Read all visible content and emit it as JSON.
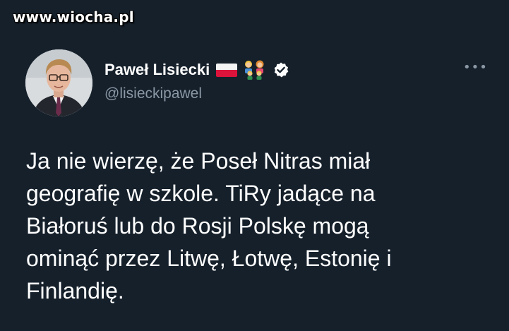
{
  "watermark": "www.wiocha.pl",
  "author": {
    "name": "Paweł Lisiecki",
    "handle": "@lisieckipawel"
  },
  "icons": {
    "flag": "poland-flag-icon",
    "family": "family-emoji-icon",
    "verified": "verified-badge-icon",
    "more": "more-options-icon"
  },
  "colors": {
    "background": "#15202b",
    "text": "#ffffff",
    "secondary": "#8b98a5"
  },
  "tweet": {
    "lines": [
      "Ja nie wierzę, że Poseł Nitras miał",
      "geografię w szkole. TiRy jadące na",
      "Białoruś lub do Rosji Polskę mogą",
      "ominąć przez Litwę, Łotwę, Estonię i",
      "Finlandię."
    ]
  },
  "more_glyph": "•••"
}
